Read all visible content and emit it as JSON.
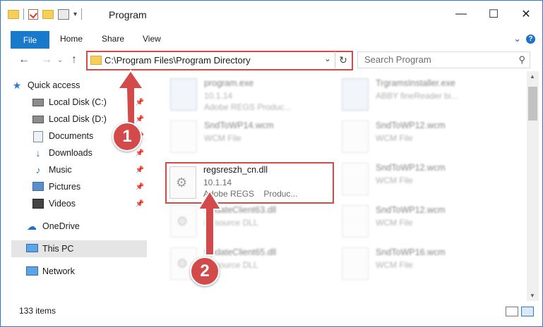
{
  "window": {
    "title": "Program",
    "controls": {
      "minimize": "—",
      "maximize": "☐",
      "close": "✕"
    }
  },
  "ribbon": {
    "tabs": [
      "File",
      "Home",
      "Share",
      "View"
    ]
  },
  "nav": {
    "back_icon": "←",
    "forward_icon": "→",
    "up_icon": "↑"
  },
  "address": {
    "path": "C:\\Program Files\\Program Directory",
    "dropdown_icon": "⌄",
    "refresh_icon": "↻"
  },
  "search": {
    "placeholder": "Search Program",
    "icon": "⚲"
  },
  "sidebar": {
    "items": [
      {
        "label": "Quick access",
        "icon": "star-icon",
        "pinned": false
      },
      {
        "label": "Local Disk (C:)",
        "icon": "drive-icon",
        "pinned": true
      },
      {
        "label": "Local Disk (D:)",
        "icon": "drive-icon",
        "pinned": true
      },
      {
        "label": "Documents",
        "icon": "documents-icon",
        "pinned": true
      },
      {
        "label": "Downloads",
        "icon": "downloads-icon",
        "pinned": true
      },
      {
        "label": "Music",
        "icon": "music-icon",
        "pinned": true
      },
      {
        "label": "Pictures",
        "icon": "pictures-icon",
        "pinned": true
      },
      {
        "label": "Videos",
        "icon": "videos-icon",
        "pinned": true
      },
      {
        "label": "OneDrive",
        "icon": "cloud-icon",
        "pinned": false
      },
      {
        "label": "This PC",
        "icon": "computer-icon",
        "pinned": false,
        "selected": true
      },
      {
        "label": "Network",
        "icon": "network-icon",
        "pinned": false
      }
    ]
  },
  "files": {
    "left": [
      {
        "name": "program.exe",
        "line2": "10.1.14",
        "line3": "Adobe REGS   Produc..."
      },
      {
        "name": "SndToWP14.wcm",
        "line2": "WCM File",
        "line3": ""
      },
      {
        "name": "regsreszh_cn.dll",
        "line2": "10.1.14",
        "line3": "Adobe REGS",
        "line3b": "Produc..."
      },
      {
        "name": "UpdateClient63.dll",
        "line2": "Resource DLL",
        "line3": ""
      },
      {
        "name": "UpdateClient65.dll",
        "line2": "Resource DLL",
        "line3": ""
      }
    ],
    "right": [
      {
        "name": "TrgramsInstaller.exe",
        "line2": "ABBY fineReader bi...",
        "line3": ""
      },
      {
        "name": "SndToWP12.wcm",
        "line2": "WCM File",
        "line3": ""
      },
      {
        "name": "SndToWP12.wcm",
        "line2": "WCM File",
        "line3": ""
      },
      {
        "name": "SndToWP12.wcm",
        "line2": "WCM File",
        "line3": ""
      },
      {
        "name": "SndToWP16.wcm",
        "line2": "WCM File",
        "line3": ""
      }
    ]
  },
  "status": {
    "count": "133 items"
  },
  "callouts": {
    "step1": "1",
    "step2": "2"
  },
  "colors": {
    "accent": "#1979ca",
    "highlight": "#d34a4a",
    "selected_bg": "#e5e5e5"
  }
}
